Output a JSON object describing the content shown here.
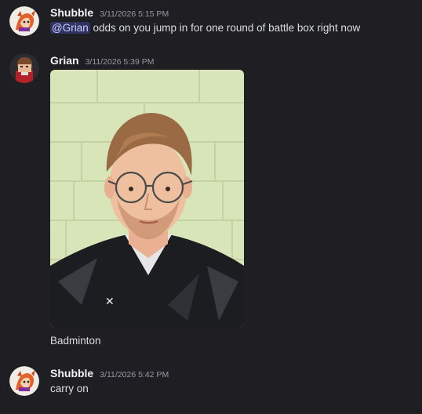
{
  "messages": [
    {
      "author": "Shubble",
      "timestamp": "3/11/2026 5:15 PM",
      "mention": "@Grian",
      "text": "odds on you jump in for one round of battle box right now"
    },
    {
      "author": "Grian",
      "timestamp": "3/11/2026 5:39 PM",
      "attachment": "photo of a man with glasses and reddish hair in a black athletic shirt against a pale green brick wall",
      "text": "Badminton"
    },
    {
      "author": "Shubble",
      "timestamp": "3/11/2026 5:42 PM",
      "text": "carry on"
    }
  ],
  "colors": {
    "background": "#1f1f23",
    "author": "#f2f3f5",
    "timestamp": "#949ba4",
    "text": "#dbdee1",
    "mention_bg": "#3f4675",
    "mention_text": "#c9cdfb"
  },
  "icons": [
    "shubble-avatar",
    "grian-avatar"
  ]
}
